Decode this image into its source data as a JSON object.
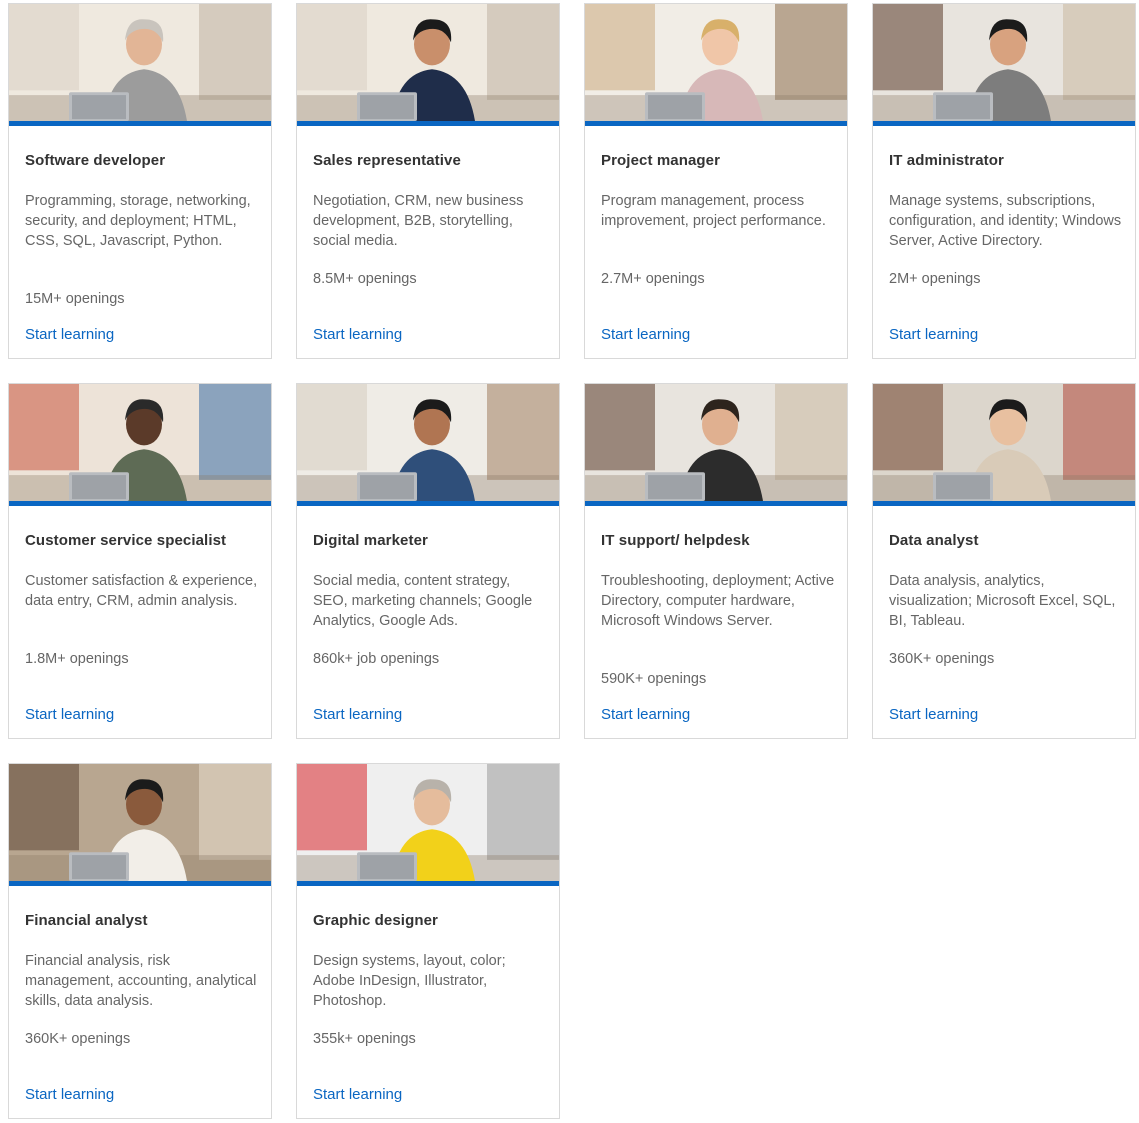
{
  "accent_color": "#0a66c2",
  "cta_label": "Start learning",
  "cards": [
    {
      "title": "Software developer",
      "description": "Programming, storage, networking, security, and deployment; HTML, CSS, SQL, Javascript, Python.",
      "openings": "15M+ openings",
      "desc_lines": 4,
      "scene": "office"
    },
    {
      "title": "Sales representative",
      "description": "Negotiation, CRM, new business development, B2B, storytelling, social media.",
      "openings": "8.5M+ openings",
      "desc_lines": 3,
      "scene": "office"
    },
    {
      "title": "Project manager",
      "description": "Program management, process improvement, project performance.",
      "openings": "2.7M+ openings",
      "desc_lines": 3,
      "scene": "shop"
    },
    {
      "title": "IT administrator",
      "description": "Manage systems, subscriptions, configuration, and identity; Windows Server, Active Directory.",
      "openings": "2M+ openings",
      "desc_lines": 3,
      "scene": "window"
    },
    {
      "title": "Customer service specialist",
      "description": "Customer satisfaction & experience, data entry, CRM, admin analysis.",
      "openings": "1.8M+ openings",
      "desc_lines": 3,
      "scene": "studio"
    },
    {
      "title": "Digital marketer",
      "description": "Social media, content strategy, SEO, marketing channels; Google Analytics, Google Ads.",
      "openings": "860k+ job openings",
      "desc_lines": 3,
      "scene": "hall"
    },
    {
      "title": "IT support/ helpdesk",
      "description": "Troubleshooting, deployment; Active Directory, computer hardware, Microsoft Windows Server.",
      "openings": "590K+ openings",
      "desc_lines": 4,
      "scene": "window"
    },
    {
      "title": "Data analyst",
      "description": "Data analysis, analytics, visualization; Microsoft Excel, SQL, BI, Tableau.",
      "openings": "360K+ openings",
      "desc_lines": 3,
      "scene": "library"
    },
    {
      "title": "Financial analyst",
      "description": "Financial analysis, risk management, accounting, analytical skills, data analysis.",
      "openings": "360K+ openings",
      "desc_lines": 3,
      "scene": "loft"
    },
    {
      "title": "Graphic designer",
      "description": "Design systems, layout, color; Adobe InDesign, Illustrator, Photoshop.",
      "openings": "355k+ openings",
      "desc_lines": 3,
      "scene": "living"
    }
  ]
}
